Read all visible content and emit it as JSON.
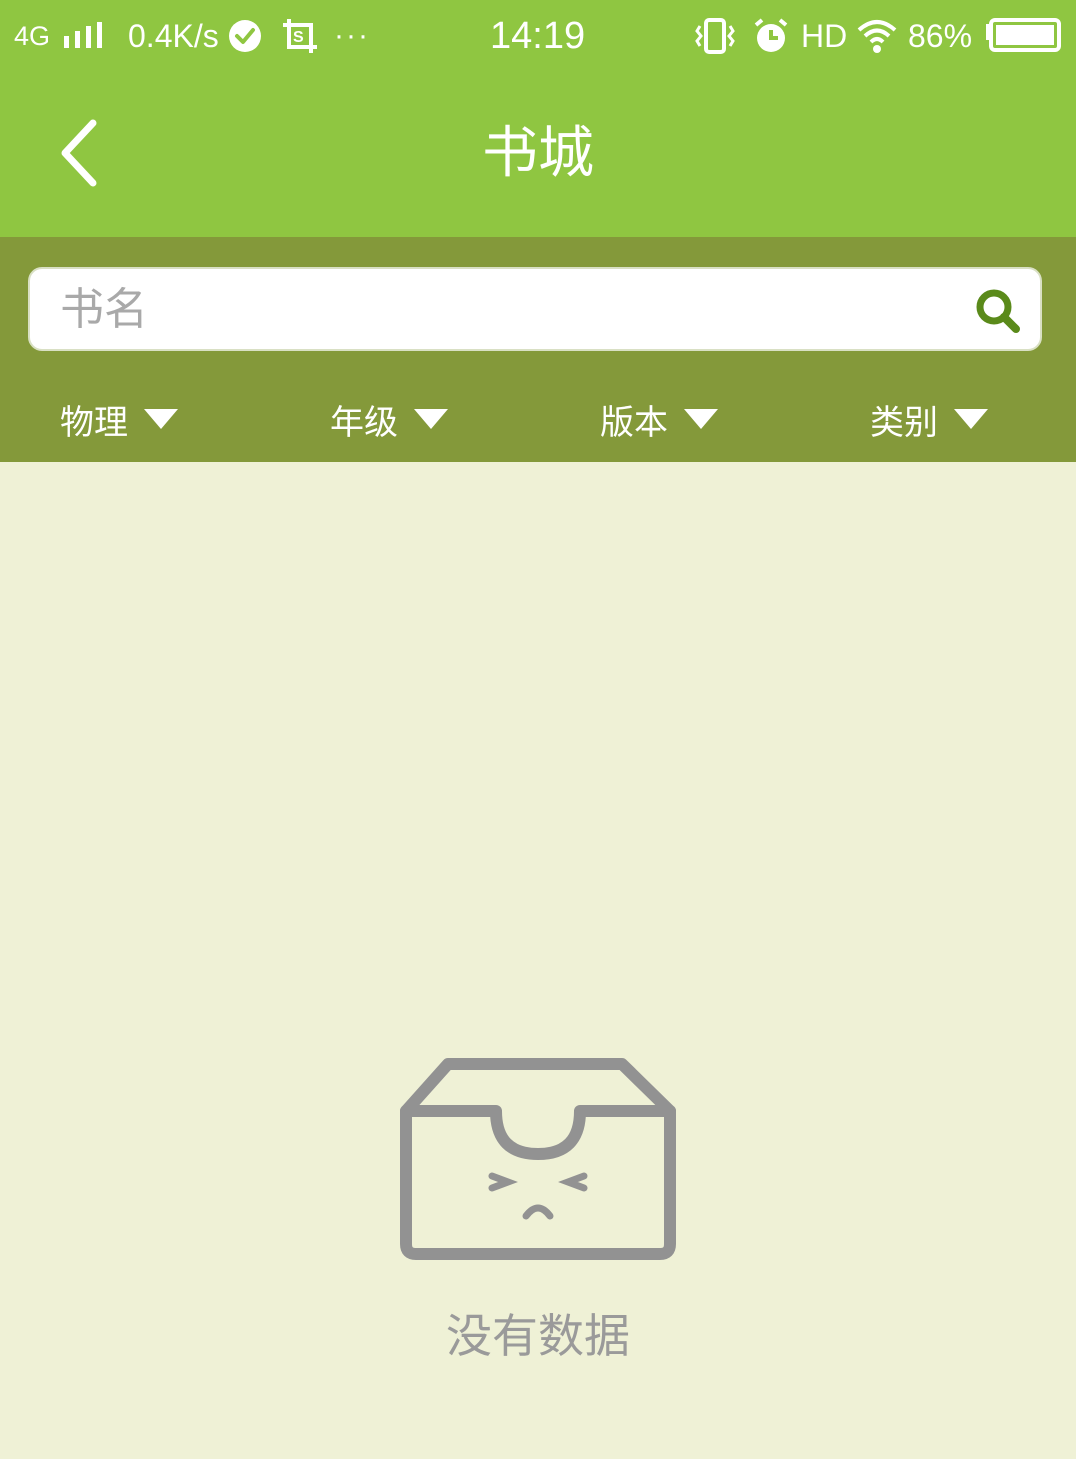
{
  "status_bar": {
    "network": "4G",
    "speed": "0.4K/s",
    "dots": "···",
    "time": "14:19",
    "hd": "HD",
    "battery_percent": "86%",
    "battery_level": 0.86
  },
  "nav": {
    "title": "书城"
  },
  "search": {
    "placeholder": "书名"
  },
  "filters": [
    {
      "label": "物理"
    },
    {
      "label": "年级"
    },
    {
      "label": "版本"
    },
    {
      "label": "类别"
    }
  ],
  "empty_state": {
    "message": "没有数据"
  },
  "colors": {
    "header": "#8fc641",
    "filter_bar": "#84993a",
    "background": "#eff1d6",
    "search_icon": "#5a8a1a",
    "empty_icon": "#929292"
  }
}
